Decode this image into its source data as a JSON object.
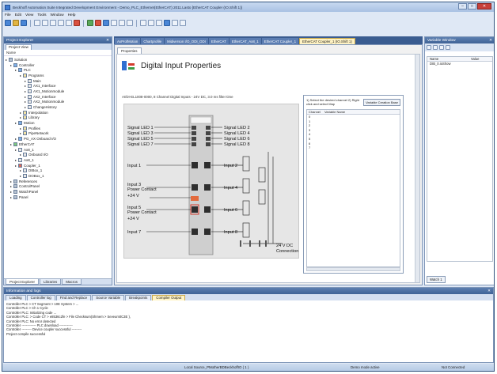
{
  "window": {
    "title": "Beckhoff Automation Suite Integrated Development Environment - Demo_PLC_Ethernet(EtherCAT) 2011.Lasto [EtherCAT Coupler (IO.Shift 1)]",
    "min": "–",
    "max": "□",
    "close": "✕"
  },
  "menu": [
    "File",
    "Edit",
    "View",
    "Tools",
    "Window",
    "Help"
  ],
  "solution": {
    "header": "Project Explorer",
    "tab": "Project View",
    "name_label": "Name",
    "tree": [
      {
        "label": "Solution",
        "depth": 0,
        "icon": "gray"
      },
      {
        "label": "Controller",
        "depth": 1,
        "icon": "plc"
      },
      {
        "label": "PLC",
        "depth": 2,
        "icon": "plc"
      },
      {
        "label": "Programs",
        "depth": 3,
        "icon": "folder"
      },
      {
        "label": "Main",
        "depth": 4,
        "icon": "box"
      },
      {
        "label": "AX1_Interface",
        "depth": 4,
        "icon": "box"
      },
      {
        "label": "AX1_Motionmodule",
        "depth": 4,
        "icon": "box"
      },
      {
        "label": "AX2_Interface",
        "depth": 4,
        "icon": "box"
      },
      {
        "label": "AX2_Motionmodule",
        "depth": 4,
        "icon": "box"
      },
      {
        "label": "ChangeHistory",
        "depth": 4,
        "icon": "box"
      },
      {
        "label": "Interpolation",
        "depth": 3,
        "icon": "folder"
      },
      {
        "label": "Library",
        "depth": 3,
        "icon": "folder"
      },
      {
        "label": "Motion",
        "depth": 2,
        "icon": "plc"
      },
      {
        "label": "Profiles",
        "depth": 3,
        "icon": "folder"
      },
      {
        "label": "PipeNetwork",
        "depth": 3,
        "icon": "folder"
      },
      {
        "label": "PG_AX Onboard I/O",
        "depth": 2,
        "icon": "plc"
      },
      {
        "label": "EtherCAT",
        "depth": 1,
        "icon": "ec"
      },
      {
        "label": "Ax8_1",
        "depth": 2,
        "icon": "box"
      },
      {
        "label": "Onboard I/O",
        "depth": 3,
        "icon": "box"
      },
      {
        "label": "Ax8_1",
        "depth": 2,
        "icon": "box"
      },
      {
        "label": "Coupler_1",
        "depth": 2,
        "icon": "red"
      },
      {
        "label": "DIBox_1",
        "depth": 3,
        "icon": "box"
      },
      {
        "label": "DOBox_1",
        "depth": 3,
        "icon": "box"
      },
      {
        "label": "References",
        "depth": 1,
        "icon": "gray"
      },
      {
        "label": "ControlPanel",
        "depth": 1,
        "icon": "gray"
      },
      {
        "label": "WatchPanel",
        "depth": 1,
        "icon": "gray"
      },
      {
        "label": "Panel",
        "depth": 1,
        "icon": "gray"
      }
    ],
    "bottom_tabs": [
      "Project Explorer",
      "Libraries",
      "Macros"
    ]
  },
  "doc_tabs": [
    "AxProfMotion",
    "Chartprofile",
    "Midiverson I/O_ODI_ODI",
    "EtherCAT",
    "EtherCAT_Ax8_1",
    "EtherCAT Coupler_1",
    "EtherCAT Coupler_1 (IO.Shift 1)"
  ],
  "editor": {
    "subtab": "Properties",
    "title": "Digital Input Properties",
    "description": "AI/DI-EL1008-0000, 8 Channel Digital Inputs - 24V DC, 3.0 ms filter time",
    "module_labels": {
      "left": [
        "Signal LED 1",
        "Signal LED 3",
        "Signal LED 5",
        "Signal LED 7",
        "Input 1",
        "Input 3",
        "Power Contact",
        "+24 V",
        "Input 5",
        "Power Contact",
        "+24 V",
        "Input 7"
      ],
      "right": [
        "Signal LED 2",
        "Signal LED 4",
        "Signal LED 6",
        "Signal LED 8",
        "Input 2",
        "Input 4",
        "Input 6",
        "Input 8"
      ],
      "supply": "24 V DC",
      "connection": "Connection"
    }
  },
  "variables": {
    "help": "1) Select the desired channel 2) Right click and select Map",
    "button": "Variable Creation Base",
    "col_channel": "Channel",
    "col_name": "Variable Name",
    "rows": [
      "0",
      "1",
      "2",
      "3",
      "4",
      "5",
      "6",
      "7"
    ]
  },
  "toolbox": {
    "header": "Variable Window",
    "col_name": "Name",
    "col_value": "Value",
    "rows": [
      "DIB_0.ioShow"
    ],
    "footer": "Watch 1"
  },
  "output": {
    "header": "Information and logs",
    "tabs": [
      "Loading",
      "Controller log",
      "Find and Replace",
      "Source Variable",
      "Breakpoints",
      "Compiler Output"
    ],
    "active_tab": "Compiler Output",
    "lines": [
      "Controller PLC > CT Segment > 10E System > ...",
      "Controller PLC > Ch 1 Cycle",
      "Controller PLC: Initializing code ...",
      "Controller PLC: > Code CT > e8536c2fe > File Checksum(Shmem > Seveum0C3E ),",
      "Controller PLC: No error detected",
      "Controller ------------- PLC download ------------",
      "Controller --------- Device coupler successful ---------",
      "Project compile successful"
    ]
  },
  "status": {
    "center": "Local Source_PMotherBDBeckhoffIO ( 1 )",
    "mode": "Demo mode active",
    "connection": "Not Connected"
  }
}
